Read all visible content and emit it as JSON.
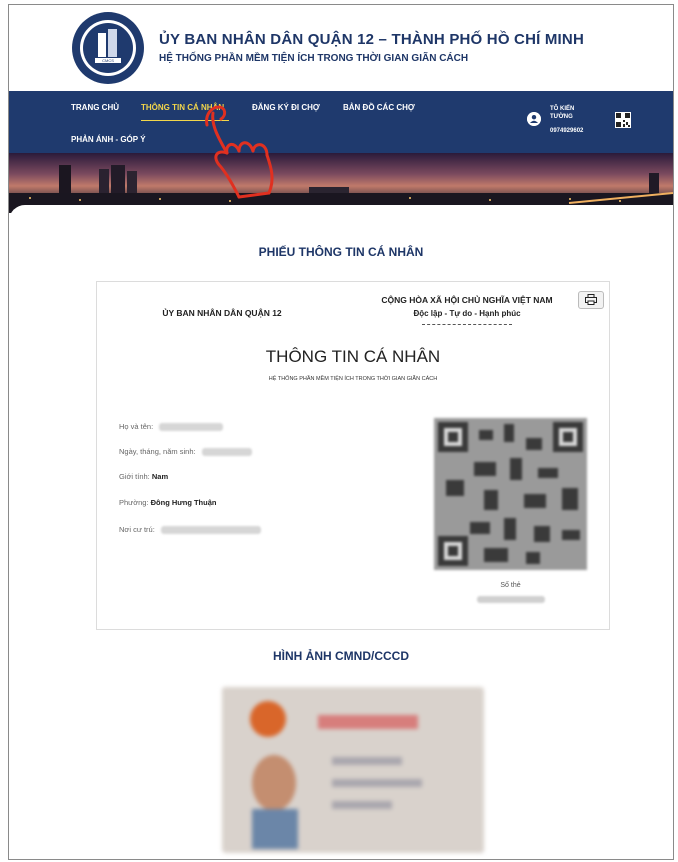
{
  "header": {
    "title": "ỦY BAN NHÂN DÂN QUẬN 12 – THÀNH PHỐ HỒ CHÍ MINH",
    "subtitle": "HỆ THỐNG PHẦN MỀM TIỆN ÍCH TRONG THỜI GIAN GIÃN CÁCH",
    "logo_text": "CMCS"
  },
  "nav": {
    "items": [
      {
        "label": "TRANG CHỦ"
      },
      {
        "label": "THÔNG TIN CÁ NHÂN"
      },
      {
        "label": "ĐĂNG KÝ ĐI CHỢ"
      },
      {
        "label": "BẢN ĐỒ CÁC CHỢ"
      },
      {
        "label": "PHẢN ÁNH - GÓP Ý"
      }
    ],
    "active_index": 1,
    "user": {
      "name": "TÔ KIẾN TƯỜNG",
      "phone": "0974929602"
    }
  },
  "main": {
    "section_title": "PHIẾU THÔNG TIN CÁ NHÂN",
    "card": {
      "left_org": "ỦY BAN NHÂN DÂN QUẬN 12",
      "republic": "CỘNG HÒA XÃ HỘI CHỦ NGHĨA VIỆT NAM",
      "motto": "Độc lập - Tự do - Hạnh phúc",
      "title": "THÔNG TIN CÁ NHÂN",
      "subtitle": "HỆ THỐNG PHẦN MỀM TIỆN ÍCH TRONG THỜI GIAN GIÃN CÁCH",
      "fields": [
        {
          "label": "Họ và tên:",
          "value": ""
        },
        {
          "label": "Ngày, tháng, năm sinh:",
          "value": ""
        },
        {
          "label": "Giới tính:",
          "value": "Nam"
        },
        {
          "label": "Phường:",
          "value": "Đông Hưng Thuận"
        },
        {
          "label": "Nơi cư trú:",
          "value": ""
        }
      ],
      "card_number_label": "Số thẻ"
    },
    "id_section_title": "HÌNH ẢNH CMND/CCCD"
  },
  "colors": {
    "primary": "#1f3a6e",
    "accent": "#f2d64b",
    "pointer": "#e03020"
  }
}
